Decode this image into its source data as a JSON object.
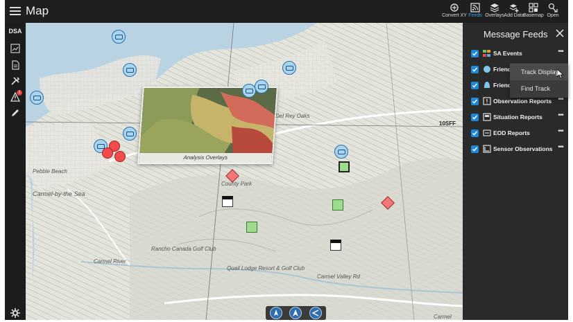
{
  "app": {
    "title": "Map",
    "menu_icon": "hamburger-icon"
  },
  "toolbar": {
    "tools": [
      {
        "label": "Convert XY",
        "icon": "convert-xy-icon",
        "active": false
      },
      {
        "label": "Feeds",
        "icon": "feeds-icon",
        "active": true
      },
      {
        "label": "Overlays",
        "icon": "overlays-icon",
        "active": false
      },
      {
        "label": "Add Data",
        "icon": "add-data-icon",
        "active": false
      },
      {
        "label": "Basemap",
        "icon": "basemap-icon",
        "active": false
      },
      {
        "label": "Open",
        "icon": "open-icon",
        "active": false
      }
    ]
  },
  "rail": {
    "title": "DSA",
    "items": [
      "chart-icon",
      "document-icon",
      "tools-icon",
      "warning-icon",
      "pencil-icon"
    ],
    "badge": "1",
    "settings_icon": "gear-icon"
  },
  "map": {
    "places": {
      "carmel_by_the_sea": "Carmel-by-the Sea",
      "del_rey_oaks": "Del Rey Oaks",
      "rancho_canada": "Rancho Canada Golf Club",
      "quail_lodge": "Quail Lodge Resort & Golf Club",
      "carmel_valley_rd": "Carmel Valley Rd",
      "carmel_river": "Carmel River",
      "pebble_beach": "Pebble Beach",
      "carmel": "Carmel",
      "county_park": "County Park"
    },
    "overlay": {
      "label": "Analysis Overlays",
      "grid_ref": "10SFF",
      "scale": "50m"
    },
    "grid_label": "10SFF",
    "nav_controls": [
      "compass-icon",
      "north-arrow-icon",
      "share-location-icon"
    ]
  },
  "panel": {
    "title": "Message Feeds",
    "close_icon": "close-icon",
    "feeds": [
      {
        "name": "SA Events",
        "icon": "sa-events-icon",
        "color": "#e0a030",
        "checked": true
      },
      {
        "name": "Friendly",
        "icon": "friendly-circle-icon",
        "color": "#7ec8f0",
        "checked": true
      },
      {
        "name": "Friendly",
        "icon": "friendly-bell-icon",
        "color": "#7ec8f0",
        "checked": true
      },
      {
        "name": "Observation Reports",
        "icon": "observation-icon",
        "color": "#dddddd",
        "checked": true
      },
      {
        "name": "Situation Reports",
        "icon": "situation-icon",
        "color": "#dddddd",
        "checked": true
      },
      {
        "name": "EOD Reports",
        "icon": "eod-icon",
        "color": "#dddddd",
        "checked": true
      },
      {
        "name": "Sensor Observations",
        "icon": "sensor-icon",
        "color": "#dddddd",
        "checked": true
      }
    ],
    "more_label": "•••"
  },
  "context_menu": {
    "items": [
      "Track Display",
      "Find Track"
    ],
    "hovered": "Track Display"
  },
  "colors": {
    "accent": "#1e88d8",
    "friendly": "#a8d4f0",
    "hostile": "#f24b4b",
    "neutral": "#9edc8e"
  }
}
